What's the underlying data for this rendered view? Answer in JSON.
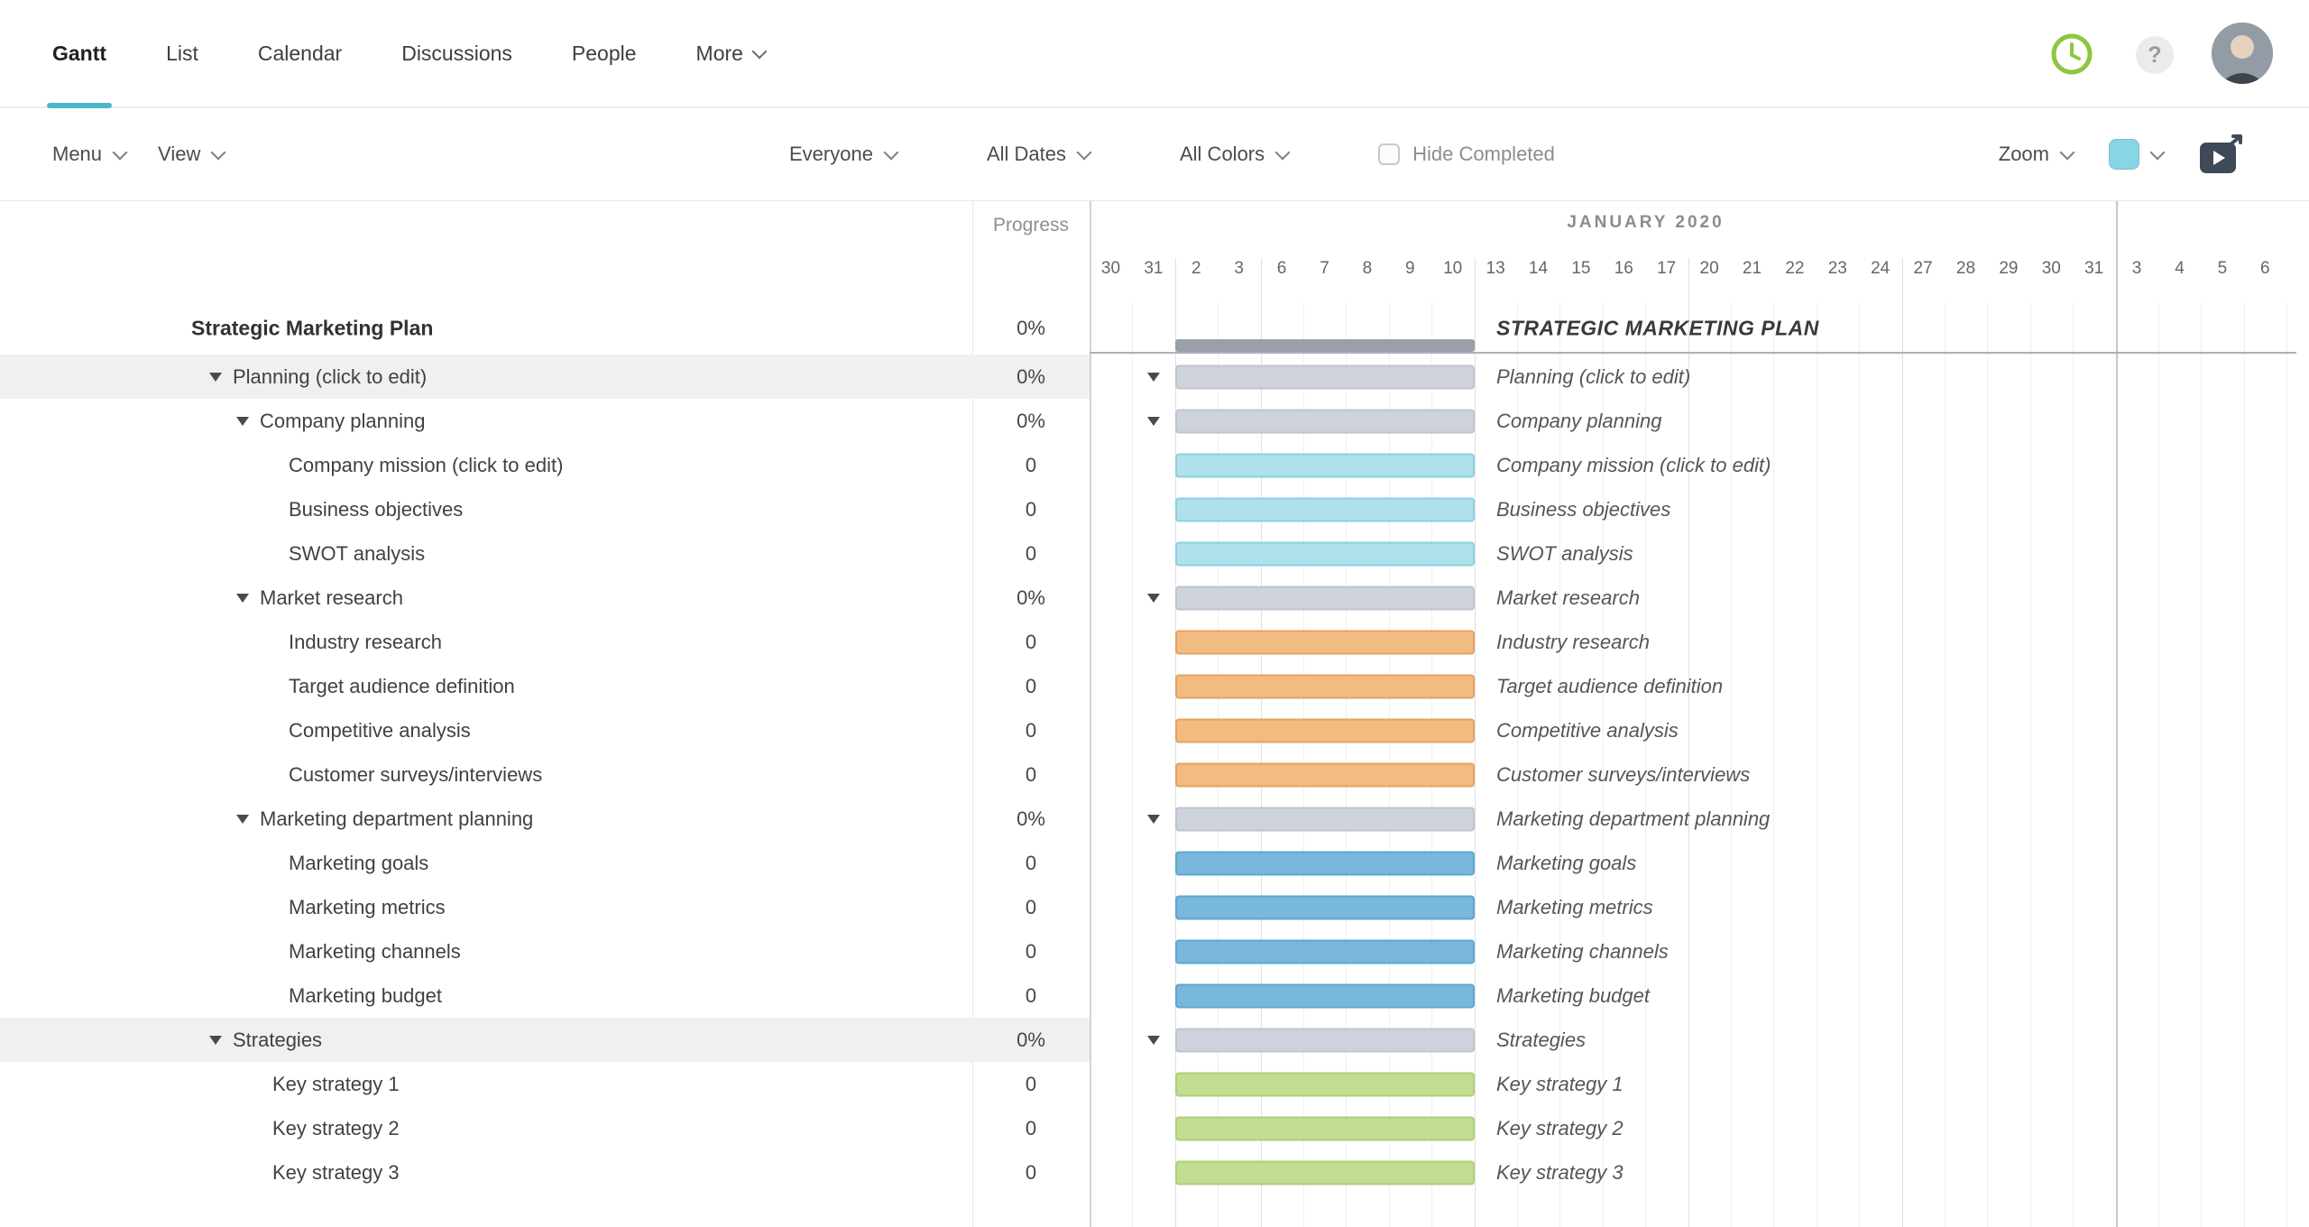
{
  "nav": {
    "tabs": [
      {
        "label": "Gantt",
        "active": true,
        "has_chevron": false
      },
      {
        "label": "List",
        "active": false,
        "has_chevron": false
      },
      {
        "label": "Calendar",
        "active": false,
        "has_chevron": false
      },
      {
        "label": "Discussions",
        "active": false,
        "has_chevron": false
      },
      {
        "label": "People",
        "active": false,
        "has_chevron": false
      },
      {
        "label": "More",
        "active": false,
        "has_chevron": true
      }
    ]
  },
  "toolbar": {
    "menu": "Menu",
    "view": "View",
    "filters": {
      "people": "Everyone",
      "dates": "All Dates",
      "colors": "All Colors"
    },
    "hide_completed": "Hide Completed",
    "hide_completed_checked": false,
    "zoom": "Zoom"
  },
  "icons": {
    "help_glyph": "?",
    "time_tracking": "clock-circle",
    "tutorial": "video-play",
    "collapse": "triangle-down",
    "chevron": "chevron-down"
  },
  "grid_header": {
    "progress": "Progress",
    "month": "JANUARY 2020",
    "days": [
      "30",
      "31",
      "2",
      "3",
      "6",
      "7",
      "8",
      "9",
      "10",
      "13",
      "14",
      "15",
      "16",
      "17",
      "20",
      "21",
      "22",
      "23",
      "24",
      "27",
      "28",
      "29",
      "30",
      "31",
      "3",
      "4",
      "5",
      "6"
    ],
    "week_start_cols": [
      2,
      4,
      9,
      14,
      19,
      24
    ],
    "month_boundary_col": 24
  },
  "chart": {
    "bar_span_cols": [
      2,
      8
    ]
  },
  "project": {
    "name": "Strategic Marketing Plan",
    "progress": "0%",
    "chart_label": "STRATEGIC MARKETING PLAN"
  },
  "tasks": [
    {
      "name": "Planning (click to edit)",
      "progress": "0%",
      "type": "group",
      "indent": 1,
      "color": "gray",
      "shaded": true
    },
    {
      "name": "Company planning",
      "progress": "0%",
      "type": "group",
      "indent": 2,
      "color": "gray",
      "shaded": false
    },
    {
      "name": "Company mission (click to edit)",
      "progress": "0",
      "type": "task",
      "indent": 3,
      "color": "cyan",
      "shaded": false
    },
    {
      "name": "Business objectives",
      "progress": "0",
      "type": "task",
      "indent": 3,
      "color": "cyan",
      "shaded": false
    },
    {
      "name": "SWOT analysis",
      "progress": "0",
      "type": "task",
      "indent": 3,
      "color": "cyan",
      "shaded": false
    },
    {
      "name": "Market research",
      "progress": "0%",
      "type": "group",
      "indent": 2,
      "color": "gray",
      "shaded": false
    },
    {
      "name": "Industry research",
      "progress": "0",
      "type": "task",
      "indent": 3,
      "color": "orange",
      "shaded": false
    },
    {
      "name": "Target audience definition",
      "progress": "0",
      "type": "task",
      "indent": 3,
      "color": "orange",
      "shaded": false
    },
    {
      "name": "Competitive analysis",
      "progress": "0",
      "type": "task",
      "indent": 3,
      "color": "orange",
      "shaded": false
    },
    {
      "name": "Customer surveys/interviews",
      "progress": "0",
      "type": "task",
      "indent": 3,
      "color": "orange",
      "shaded": false
    },
    {
      "name": "Marketing department planning",
      "progress": "0%",
      "type": "group",
      "indent": 2,
      "color": "gray",
      "shaded": false
    },
    {
      "name": "Marketing goals",
      "progress": "0",
      "type": "task",
      "indent": 3,
      "color": "blue",
      "shaded": false
    },
    {
      "name": "Marketing metrics",
      "progress": "0",
      "type": "task",
      "indent": 3,
      "color": "blue",
      "shaded": false
    },
    {
      "name": "Marketing channels",
      "progress": "0",
      "type": "task",
      "indent": 3,
      "color": "blue",
      "shaded": false
    },
    {
      "name": "Marketing budget",
      "progress": "0",
      "type": "task",
      "indent": 3,
      "color": "blue",
      "shaded": false
    },
    {
      "name": "Strategies",
      "progress": "0%",
      "type": "group",
      "indent": 1,
      "color": "gray",
      "shaded": true
    },
    {
      "name": "Key strategy 1",
      "progress": "0",
      "type": "task",
      "indent": 2,
      "color": "green",
      "shaded": false
    },
    {
      "name": "Key strategy 2",
      "progress": "0",
      "type": "task",
      "indent": 2,
      "color": "green",
      "shaded": false
    },
    {
      "name": "Key strategy 3",
      "progress": "0",
      "type": "task",
      "indent": 2,
      "color": "green",
      "shaded": false
    }
  ],
  "colors": {
    "accent": "#4db6c9",
    "clock_green": "#8dc63f",
    "zoom_swatch": "#87d5e5",
    "bars": {
      "gray": {
        "fill": "#ced3db",
        "border": "#bfc4cf"
      },
      "cyan": {
        "fill": "#b0e0eb",
        "border": "#8bcfdf"
      },
      "orange": {
        "fill": "#f2bc80",
        "border": "#e3a361"
      },
      "blue": {
        "fill": "#79b7db",
        "border": "#5ea7d1"
      },
      "green": {
        "fill": "#c3dd94",
        "border": "#aed076"
      },
      "project": {
        "fill": "#99a0ab",
        "border": "#8d949f"
      }
    }
  }
}
